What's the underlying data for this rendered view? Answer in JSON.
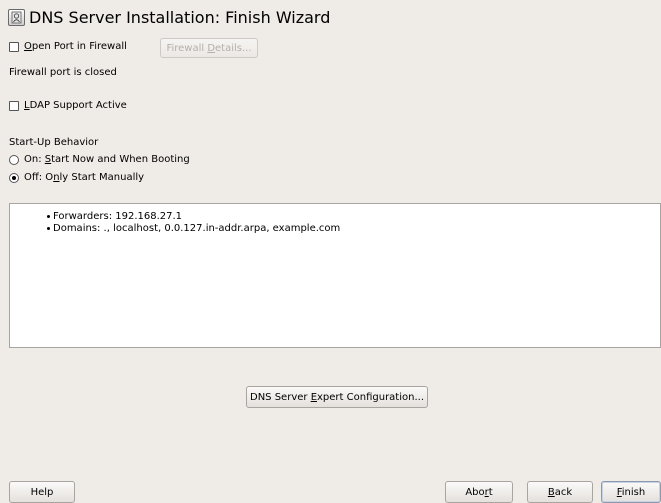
{
  "window": {
    "title": "DNS Server Installation: Finish Wizard",
    "icon": "yast-dns-icon"
  },
  "firewall": {
    "open_port_label": "Open Port in Firewall",
    "open_port_checked": false,
    "details_button": "Firewall Details...",
    "details_enabled": false,
    "status_text": "Firewall port is closed"
  },
  "ldap": {
    "label": "LDAP Support Active",
    "checked": false
  },
  "startup": {
    "heading": "Start-Up Behavior",
    "option_on": "On: Start Now and When Booting",
    "option_off": "Off: Only Start Manually",
    "selected": "off"
  },
  "summary": {
    "items": [
      "Forwarders: 192.168.27.1",
      "Domains: ., localhost, 0.0.127.in-addr.arpa, example.com"
    ]
  },
  "expert_button": "DNS Server Expert Configuration...",
  "footer": {
    "help": "Help",
    "abort": "Abort",
    "back": "Back",
    "finish": "Finish"
  }
}
